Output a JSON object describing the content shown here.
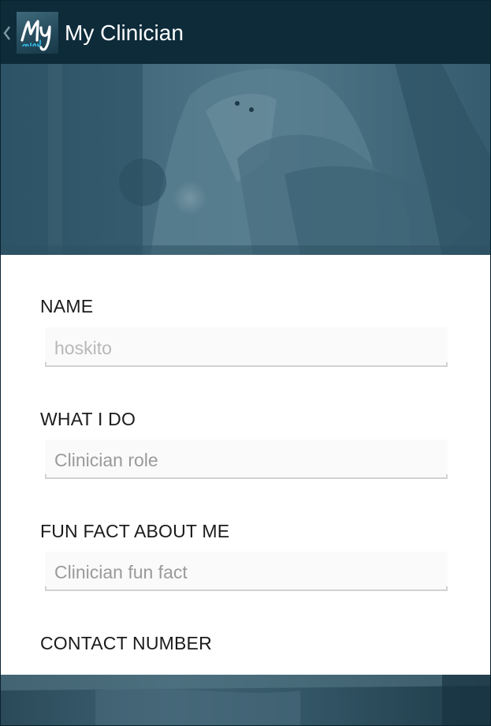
{
  "action_bar": {
    "title": "My Clinician",
    "logo_icon": "my-mind-logo-icon",
    "up_icon": "chevron-left-icon",
    "background_color": "#0e2b3a"
  },
  "hero": {
    "image": "clinician-photo-teal-tint",
    "tint_color": "#3a6275"
  },
  "form": {
    "name": {
      "label": "NAME",
      "value": "hoskito",
      "placeholder": ""
    },
    "what_i_do": {
      "label": "WHAT I DO",
      "value": "",
      "placeholder": "Clinician role"
    },
    "fun_fact": {
      "label": "FUN FACT ABOUT ME",
      "value": "",
      "placeholder": "Clinician fun fact"
    },
    "contact_number": {
      "label": "CONTACT NUMBER"
    }
  },
  "footer": {
    "image": "clinician-photo-strip"
  }
}
